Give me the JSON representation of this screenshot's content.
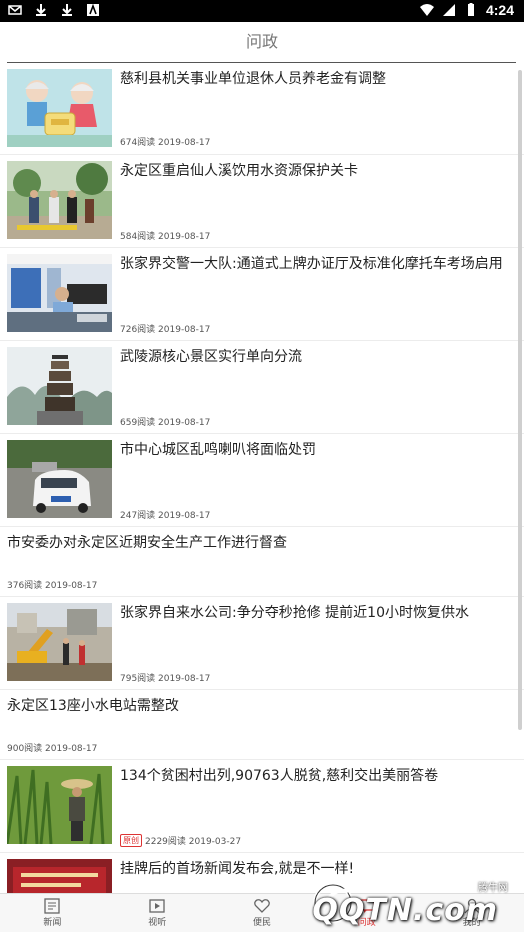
{
  "status_bar": {
    "time": "4:24"
  },
  "header": {
    "title": "问政"
  },
  "articles": [
    {
      "title": "慈利县机关事业单位退休人员养老金有调整",
      "meta": "674阅读 2019-08-17",
      "thumb": "elderly-couple-illustration"
    },
    {
      "title": "永定区重启仙人溪饮用水资源保护关卡",
      "meta": "584阅读 2019-08-17",
      "thumb": "people-at-checkpoint"
    },
    {
      "title": "张家界交警一大队:通道式上牌办证厅及标准化摩托车考场启用",
      "meta": "726阅读 2019-08-17",
      "thumb": "service-hall"
    },
    {
      "title": "武陵源核心景区实行单向分流",
      "meta": "659阅读 2019-08-17",
      "thumb": "pagoda-mountains"
    },
    {
      "title": "市中心城区乱鸣喇叭将面临处罚",
      "meta": "247阅读 2019-08-17",
      "thumb": "street-car"
    },
    {
      "title": "市安委办对永定区近期安全生产工作进行督查",
      "meta": "376阅读 2019-08-17"
    },
    {
      "title": "张家界自来水公司:争分夺秒抢修 提前近10小时恢复供水",
      "meta": "795阅读 2019-08-17",
      "thumb": "excavator-repair"
    },
    {
      "title": "永定区13座小水电站需整改",
      "meta": "900阅读 2019-08-17"
    },
    {
      "title": "134个贫困村出列,90763人脱贫,慈利交出美丽答卷",
      "badge": "原创",
      "meta": "2229阅读 2019-03-27",
      "thumb": "farmer-field"
    },
    {
      "title": "挂牌后的首场新闻发布会,就是不一样!",
      "meta": "",
      "thumb": "press-conference"
    }
  ],
  "tabs": [
    {
      "label": "新闻",
      "icon": "news-icon"
    },
    {
      "label": "视听",
      "icon": "video-icon"
    },
    {
      "label": "便民",
      "icon": "heart-icon"
    },
    {
      "label": "问政",
      "icon": "ask-icon",
      "active": true
    },
    {
      "label": "我的",
      "icon": "user-icon"
    }
  ],
  "watermark": {
    "text": "QQTN.com",
    "cn": "腾牛网"
  },
  "colors": {
    "accent": "#d33333",
    "statusbar": "#000000"
  }
}
